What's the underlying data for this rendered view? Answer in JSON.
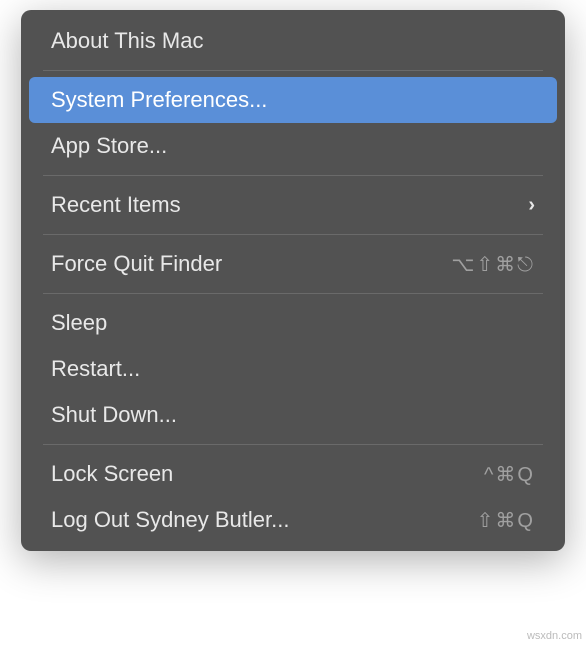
{
  "menu": {
    "about": "About This Mac",
    "system_preferences": "System Preferences...",
    "app_store": "App Store...",
    "recent_items": "Recent Items",
    "force_quit": "Force Quit Finder",
    "force_quit_shortcut": "⌥⇧⌘⎋",
    "sleep": "Sleep",
    "restart": "Restart...",
    "shut_down": "Shut Down...",
    "lock_screen": "Lock Screen",
    "lock_screen_shortcut": "^⌘Q",
    "log_out": "Log Out Sydney Butler...",
    "log_out_shortcut": "⇧⌘Q"
  },
  "watermark": "wsxdn.com"
}
